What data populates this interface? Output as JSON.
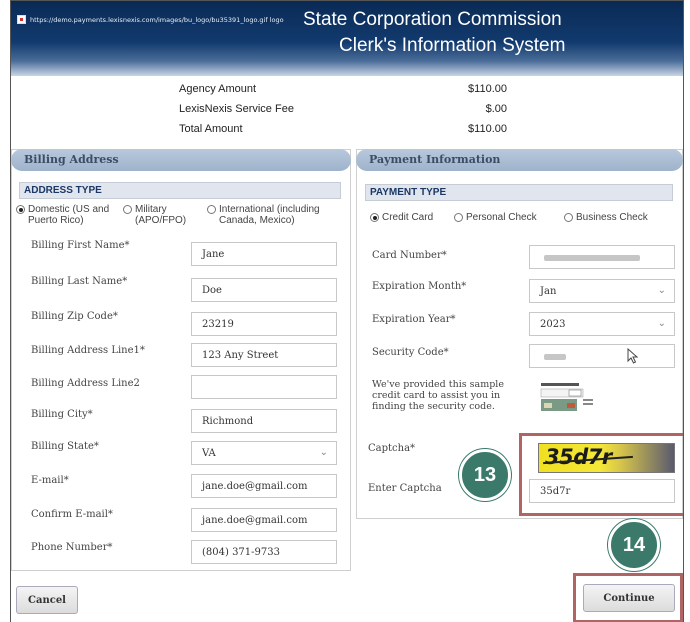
{
  "header": {
    "broken_image_alt": "https://demo.payments.lexisnexis.com/images/bu_logo/bu35391_logo.gif logo",
    "title_line1": "State Corporation Commission",
    "title_line2": "Clerk's Information System"
  },
  "summary": [
    {
      "label": "Agency Amount",
      "value": "$110.00"
    },
    {
      "label": "LexisNexis Service Fee",
      "value": "$.00"
    },
    {
      "label": "Total Amount",
      "value": "$110.00"
    }
  ],
  "billing": {
    "title": "Billing Address",
    "address_type_heading": "ADDRESS TYPE",
    "address_types": [
      {
        "label": "Domestic (US and Puerto Rico)",
        "selected": true
      },
      {
        "label": "Military (APO/FPO)",
        "selected": false
      },
      {
        "label": "International (including Canada, Mexico)",
        "selected": false
      }
    ],
    "fields": [
      {
        "label": "Billing First Name*",
        "value": "Jane"
      },
      {
        "label": "Billing Last Name*",
        "value": "Doe"
      },
      {
        "label": "Billing Zip Code*",
        "value": "23219"
      },
      {
        "label": "Billing Address Line1*",
        "value": "123 Any Street"
      },
      {
        "label": "Billing Address Line2",
        "value": ""
      },
      {
        "label": "Billing City*",
        "value": "Richmond"
      },
      {
        "label": "Billing State*",
        "value": "VA"
      },
      {
        "label": "E-mail*",
        "value": "jane.doe@gmail.com"
      },
      {
        "label": "Confirm E-mail*",
        "value": "jane.doe@gmail.com"
      },
      {
        "label": "Phone Number*",
        "value": "(804) 371-9733"
      }
    ]
  },
  "payment": {
    "title": "Payment Information",
    "payment_type_heading": "PAYMENT TYPE",
    "payment_types": [
      {
        "label": "Credit Card",
        "selected": true
      },
      {
        "label": "Personal Check",
        "selected": false
      },
      {
        "label": "Business Check",
        "selected": false
      }
    ],
    "card_number_label": "Card Number*",
    "expiration_month_label": "Expiration Month*",
    "expiration_month_value": "Jan",
    "expiration_year_label": "Expiration Year*",
    "expiration_year_value": "2023",
    "security_code_label": "Security Code*",
    "sample_card_hint": "We've provided this sample credit card to assist you in finding the security code.",
    "captcha_label": "Captcha*",
    "captcha_image_text": "35d7r",
    "enter_captcha_label": "Enter Captcha",
    "enter_captcha_value": "35d7r"
  },
  "buttons": {
    "cancel": "Cancel",
    "continue": "Continue"
  },
  "badges": {
    "step13": "13",
    "step14": "14"
  },
  "colors": {
    "header_dark": "#0a2a55",
    "panel_head": "#b8c9dc",
    "highlight": "#b06464",
    "badge": "#3b7a6b"
  }
}
